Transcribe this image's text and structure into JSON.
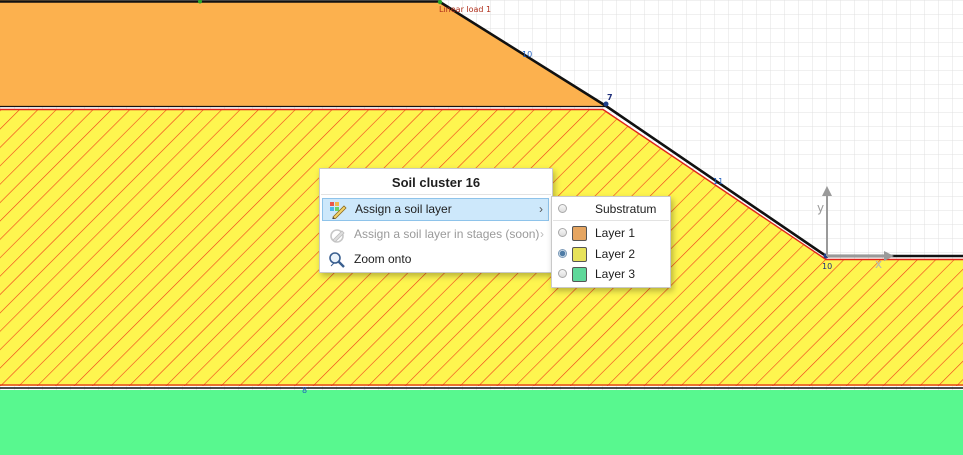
{
  "drawing": {
    "load_label": "Linear load 1",
    "point_labels": {
      "upper_slope": "10",
      "crest_of_layer2": "7",
      "lower_slope": "11",
      "toe": "10",
      "bottom_boundary": "8"
    },
    "axes": {
      "y": "y",
      "x": "x"
    },
    "colors": {
      "layer1": "#fcb14e",
      "layer2": "#fef54f",
      "layer3": "#58f88f",
      "hatch": "#f03a1a",
      "grid": "#e2e2e2"
    }
  },
  "context_menu": {
    "title": "Soil cluster 16",
    "items": [
      {
        "label": "Assign a soil layer",
        "icon": "assign-layer-icon",
        "enabled": true,
        "submenu": true,
        "highlighted": true
      },
      {
        "label": "Assign a soil layer in stages (soon)",
        "icon": "assign-stages-icon",
        "enabled": false,
        "submenu": true
      },
      {
        "label": "Zoom onto",
        "icon": "zoom-icon",
        "enabled": true,
        "submenu": false
      }
    ]
  },
  "submenu": {
    "items": [
      {
        "label": "Substratum",
        "selected": false,
        "color": null
      },
      {
        "label": "Layer 1",
        "selected": false,
        "color": "#e5a561"
      },
      {
        "label": "Layer 2",
        "selected": true,
        "color": "#e7e25a"
      },
      {
        "label": "Layer 3",
        "selected": false,
        "color": "#5fd89a"
      }
    ]
  }
}
